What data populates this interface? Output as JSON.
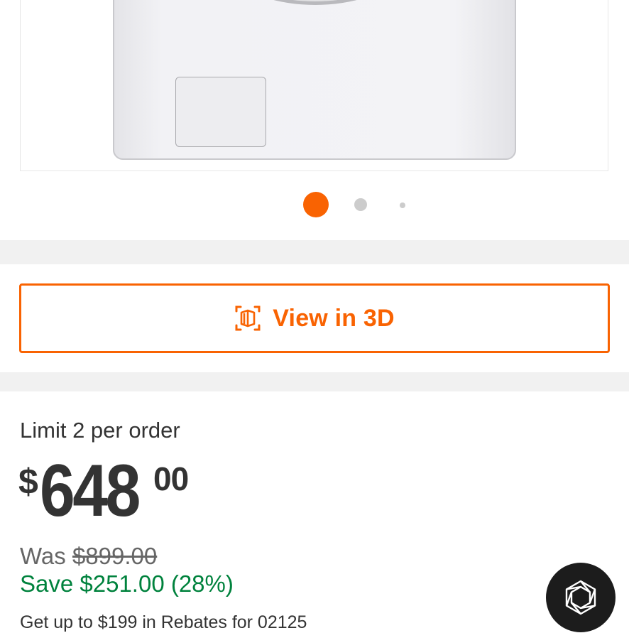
{
  "gallery": {
    "image_alt": "washer",
    "dots_count": 3,
    "active_dot": 1
  },
  "view3d": {
    "label": "View in 3D",
    "icon": "view-3d-icon"
  },
  "pricing": {
    "limit": "Limit 2 per order",
    "currency": "$",
    "dollars": "648",
    "cents": "00",
    "was_label": "Was",
    "was_price": "$899.00",
    "save_text": "Save $251.00 (28%)",
    "rebate_text": "Get up to $199 in Rebates for 02125"
  },
  "chat": {
    "icon": "chat-assistant-icon"
  },
  "colors": {
    "accent": "#f96302",
    "save_green": "#00823d",
    "band_gray": "#f1f1f1"
  }
}
